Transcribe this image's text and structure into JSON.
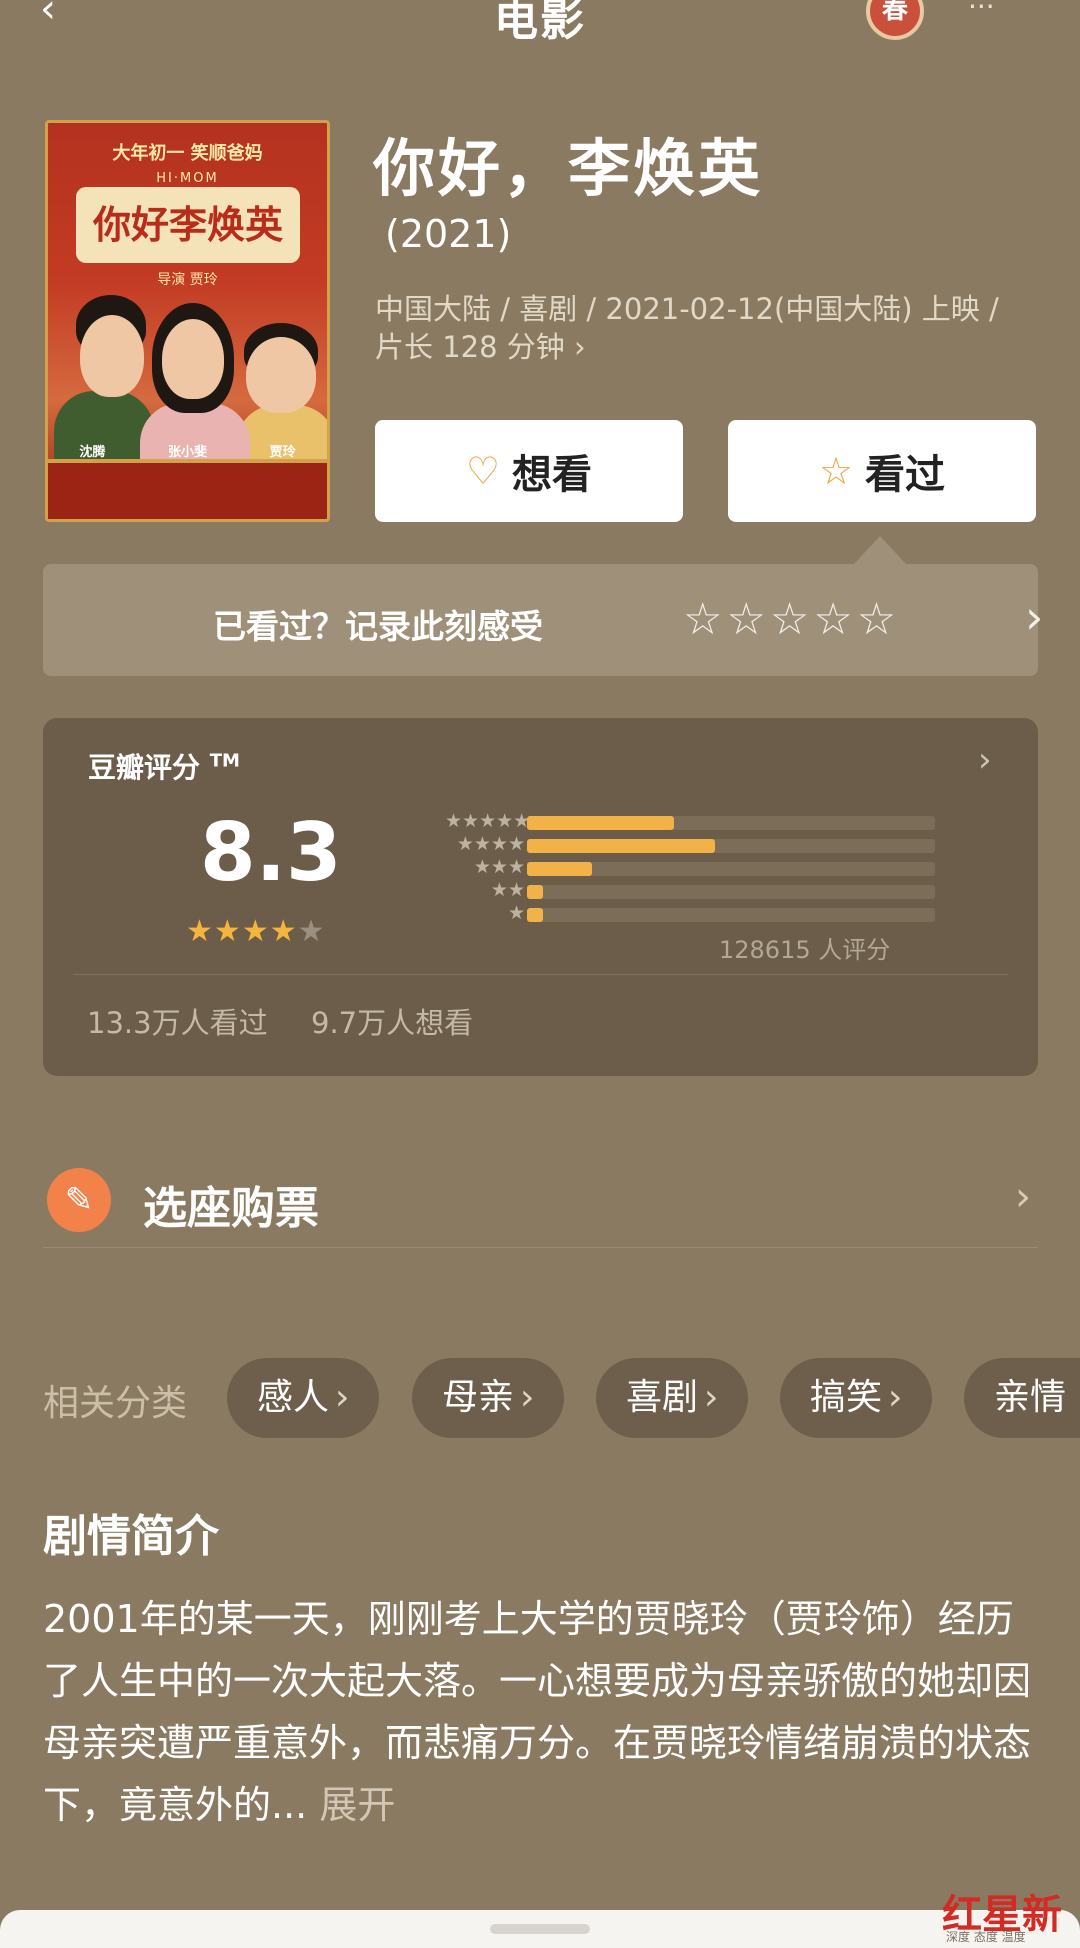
{
  "header": {
    "title": "电影",
    "back_glyph": "‹",
    "badge": "春",
    "menu_glyph": "···"
  },
  "poster": {
    "tagline": "大年初一  笑顺爸妈",
    "english": "HI·MOM",
    "title_art": "你好李焕英",
    "director": "导演  贾玲",
    "cast": [
      "沈腾",
      "张小斐",
      "贾玲"
    ]
  },
  "movie": {
    "title": "你好，李焕英",
    "year": "(2021)",
    "meta": "中国大陆 / 喜剧 / 2021-02-12(中国大陆) 上映 / 片长 128 分钟 ›"
  },
  "actions": {
    "want_label": "想看",
    "want_icon": "heart-plus-icon",
    "seen_label": "看过",
    "seen_icon": "star-outline-icon"
  },
  "record": {
    "text": "已看过？记录此刻感受",
    "stars": "☆☆☆☆☆",
    "arrow": "›"
  },
  "rating": {
    "label": "豆瓣评分",
    "tm": "TM",
    "score": "8.3",
    "stars_filled": 4,
    "stars_total": 5,
    "distribution": [
      {
        "stars": "★★★★★",
        "fraction": 0.36
      },
      {
        "stars": "★★★★",
        "fraction": 0.46
      },
      {
        "stars": "★★★",
        "fraction": 0.16
      },
      {
        "stars": "★★",
        "fraction": 0.04
      },
      {
        "stars": "★",
        "fraction": 0.04
      }
    ],
    "count": "128615 人评分",
    "seen": "13.3万人看过",
    "want": "9.7万人想看",
    "arrow": "›"
  },
  "ticket": {
    "label": "选座购票",
    "icon": "ticket-icon",
    "arrow": "›"
  },
  "categories": {
    "label": "相关分类",
    "chips": [
      {
        "label": "感人",
        "chev": "›"
      },
      {
        "label": "母亲",
        "chev": "›"
      },
      {
        "label": "喜剧",
        "chev": "›"
      },
      {
        "label": "搞笑",
        "chev": "›"
      },
      {
        "label": "亲情",
        "chev": ""
      }
    ]
  },
  "synopsis": {
    "title": "剧情简介",
    "text": "2001年的某一天，刚刚考上大学的贾晓玲（贾玲饰）经历了人生中的一次大起大落。一心想要成为母亲骄傲的她却因母亲突遭严重意外，而悲痛万分。在贾晓玲情绪崩溃的状态下，竟意外的...",
    "expand": "展开"
  },
  "watermark": {
    "text": "红星新闻",
    "sub": "深度 态度 温度"
  },
  "colors": {
    "background": "#8a7a61",
    "card": "#6b5d49",
    "accent": "#f2b247",
    "ticket": "#f2814a"
  }
}
